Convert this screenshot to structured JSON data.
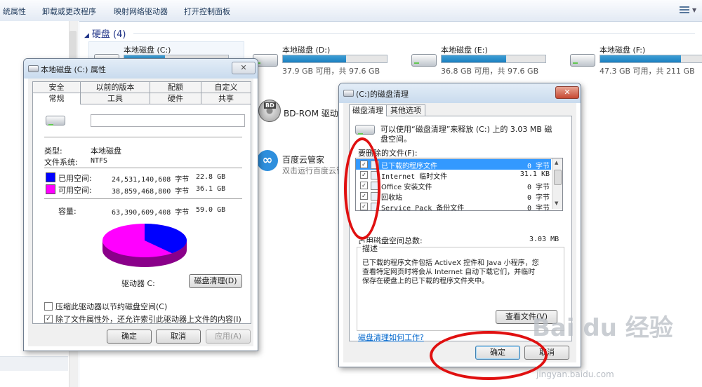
{
  "toolbar": {
    "items": [
      "统属性",
      "卸载或更改程序",
      "映射网络驱动器",
      "打开控制面板"
    ]
  },
  "explorer": {
    "group_title": "硬盘 (4)",
    "drives": [
      {
        "name": "本地磁盘 (C:)",
        "info": "",
        "used_fraction": 0.39
      },
      {
        "name": "本地磁盘 (D:)",
        "info": "37.9 GB 可用，共 97.6 GB",
        "used_fraction": 0.61
      },
      {
        "name": "本地磁盘 (E:)",
        "info": "36.8 GB 可用，共 97.6 GB",
        "used_fraction": 0.62
      },
      {
        "name": "本地磁盘 (F:)",
        "info": "47.3 GB 可用，共 211 GB",
        "used_fraction": 0.78
      }
    ],
    "bd_drive": {
      "name": "BD-ROM 驱动器",
      "badge": "BD"
    },
    "app": {
      "name": "百度云管家",
      "desc": "双击运行百度云管"
    }
  },
  "props": {
    "title": "本地磁盘 (C:) 属性",
    "tabs_top": [
      "安全",
      "以前的版本",
      "配额",
      "自定义"
    ],
    "tabs_bottom": [
      "常规",
      "工具",
      "硬件",
      "共享"
    ],
    "type_label": "类型:",
    "type_value": "本地磁盘",
    "fs_label": "文件系统:",
    "fs_value": "NTFS",
    "used_label": "已用空间:",
    "used_bytes": "24,531,140,608 字节",
    "used_gb": "22.8 GB",
    "free_label": "可用空间:",
    "free_bytes": "38,859,468,800 字节",
    "free_gb": "36.1 GB",
    "cap_label": "容量:",
    "cap_bytes": "63,390,609,408 字节",
    "cap_gb": "59.0 GB",
    "drive_label": "驱动器 C:",
    "cleanup_button": "磁盘清理(D)",
    "compress_label": "压缩此驱动器以节约磁盘空间(C)",
    "index_label": "除了文件属性外，还允许索引此驱动器上文件的内容(I)",
    "ok": "确定",
    "cancel": "取消",
    "apply": "应用(A)",
    "used_fraction": 0.387,
    "used_color": "#0000ff",
    "free_color": "#ff00ff"
  },
  "cleanup": {
    "title": "(C:)的磁盘清理",
    "tabs": [
      "磁盘清理",
      "其他选项"
    ],
    "intro_line1": "可以使用“磁盘清理”来释放  (C:) 上的 3.03 MB 磁",
    "intro_line2": "盘空间。",
    "files_label": "要删除的文件(F):",
    "files": [
      {
        "name": "已下载的程序文件",
        "size": "0 字节"
      },
      {
        "name": "Internet 临时文件",
        "size": "31.1 KB"
      },
      {
        "name": "Office 安装文件",
        "size": "0 字节"
      },
      {
        "name": "回收站",
        "size": "0 字节"
      },
      {
        "name": "Service Pack 备份文件",
        "size": "0 字节"
      }
    ],
    "total_label": "占用磁盘空间总数:",
    "total_value": "3.03 MB",
    "desc_label": "描述",
    "desc_line1": "已下载的程序文件包括 ActiveX 控件和 Java 小程序，您",
    "desc_line2": "查看特定网页时将会从 Internet 自动下载它们，并临时",
    "desc_line3": "保存在硬盘上的已下载的程序文件夹中。",
    "view_files": "查看文件(V)",
    "help_link": "磁盘清理如何工作?",
    "ok": "确定",
    "cancel": "取消"
  },
  "watermark": {
    "text": "Bai du 经验",
    "sub": "jingyan.baidu.com"
  }
}
